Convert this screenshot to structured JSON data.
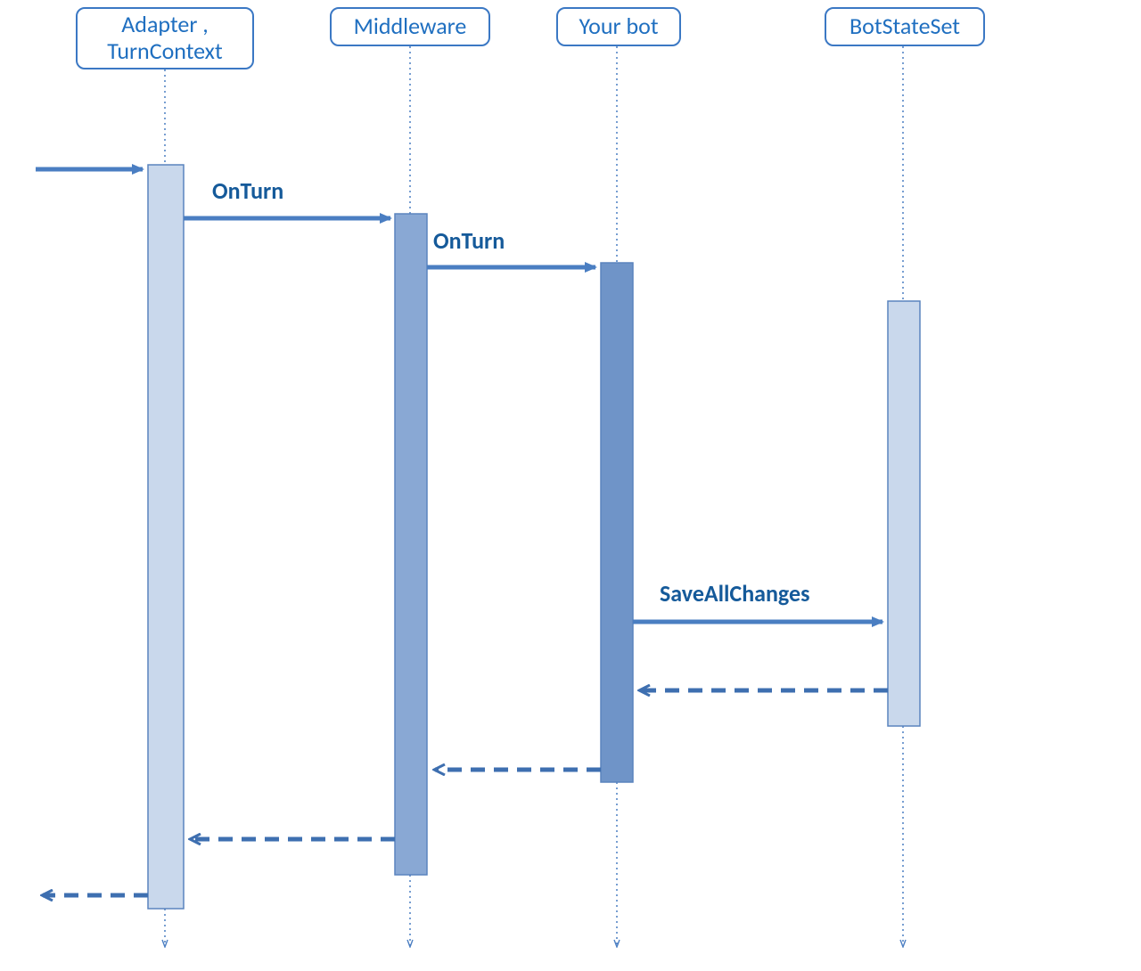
{
  "participants": {
    "adapter": {
      "label": "Adapter ,\nTurnContext"
    },
    "middleware": {
      "label": "Middleware"
    },
    "bot": {
      "label": "Your bot"
    },
    "state": {
      "label": "BotStateSet"
    }
  },
  "messages": {
    "onTurn1": {
      "label": "OnTurn"
    },
    "onTurn2": {
      "label": "OnTurn"
    },
    "saveChanges": {
      "label": "SaveAllChanges"
    }
  },
  "colors": {
    "line": "#4a7ec2",
    "dashed": "#3e6fb0",
    "text": "#155a9a",
    "barBorder": "#5a84be",
    "barLight": "#c9d8ec",
    "barMid": "#89a8d4",
    "barDark": "#6f94c8"
  }
}
